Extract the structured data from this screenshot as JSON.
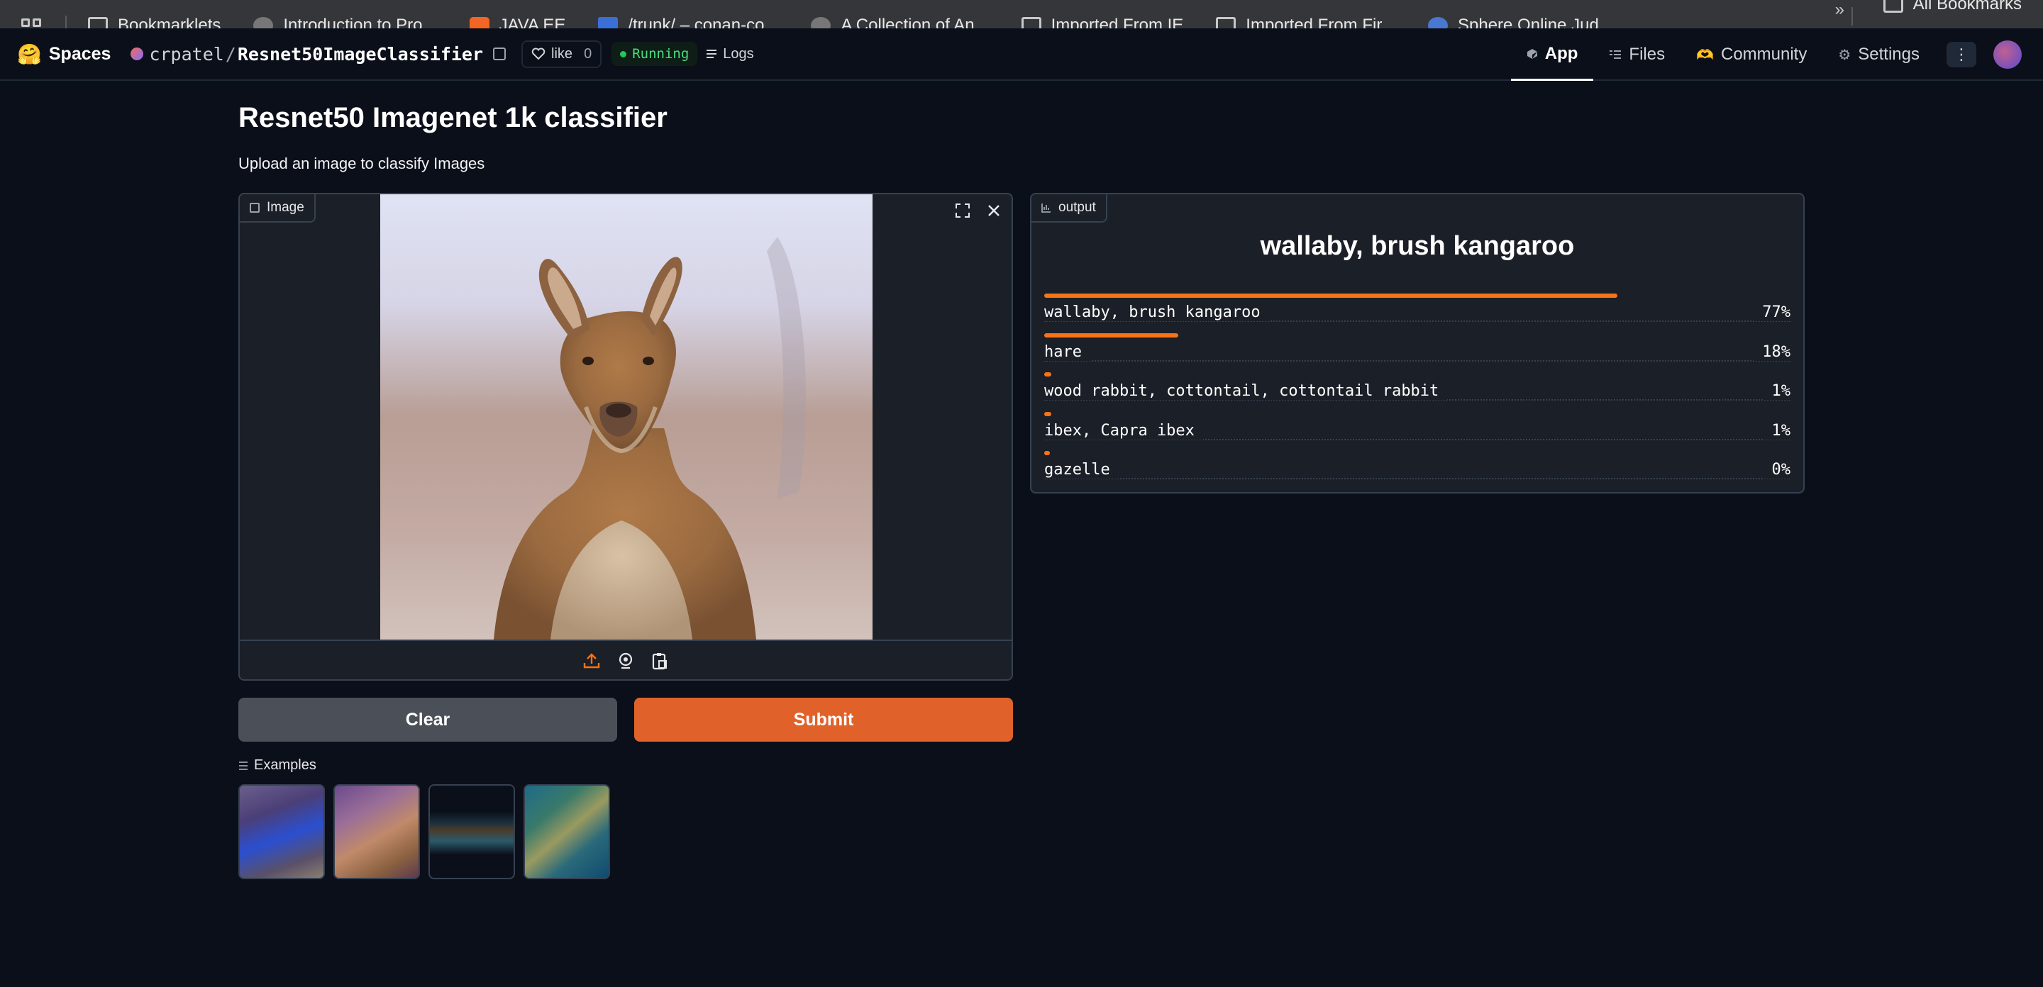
{
  "bookmarks": {
    "items": [
      {
        "label": "Bookmarklets",
        "icon": "folder-icon"
      },
      {
        "label": "Introduction to Pro...",
        "icon": "site-favicon"
      },
      {
        "label": "JAVA EE",
        "icon": "orange-favicon"
      },
      {
        "label": "/trunk/ – conan-co...",
        "icon": "trac-favicon"
      },
      {
        "label": "A Collection of An...",
        "icon": "globe-favicon"
      },
      {
        "label": "Imported From IE",
        "icon": "folder-icon"
      },
      {
        "label": "Imported From Fir...",
        "icon": "folder-icon"
      },
      {
        "label": "Sphere Online Jud...",
        "icon": "gears-favicon"
      }
    ],
    "overflow": "»",
    "all_bookmarks": "All Bookmarks"
  },
  "header": {
    "spaces": "Spaces",
    "owner": "crpatel",
    "slash": "/",
    "repo": "Resnet50ImageClassifier",
    "like_label": "like",
    "like_count": "0",
    "status": "Running",
    "logs": "Logs",
    "nav": {
      "app": "App",
      "files": "Files",
      "community": "Community",
      "settings": "Settings"
    }
  },
  "main": {
    "title": "Resnet50 Imagenet 1k classifier",
    "description": "Upload an image to classify Images",
    "image_label": "Image",
    "output_label": "output",
    "top_prediction": "wallaby, brush kangaroo",
    "predictions": [
      {
        "label": "wallaby, brush kangaroo",
        "value": "77%",
        "fraction": 0.77
      },
      {
        "label": "hare",
        "value": "18%",
        "fraction": 0.18
      },
      {
        "label": "wood rabbit, cottontail, cottontail rabbit",
        "value": "1%",
        "fraction": 0.01
      },
      {
        "label": "ibex, Capra ibex",
        "value": "1%",
        "fraction": 0.01
      },
      {
        "label": "gazelle",
        "value": "0%",
        "fraction": 0.004
      }
    ],
    "clear_label": "Clear",
    "submit_label": "Submit",
    "examples_label": "Examples"
  },
  "colors": {
    "accent": "#e0622a",
    "bar": "#f97316",
    "background": "#0b0f19",
    "panel": "#1b1f27",
    "running": "#4ade80"
  }
}
